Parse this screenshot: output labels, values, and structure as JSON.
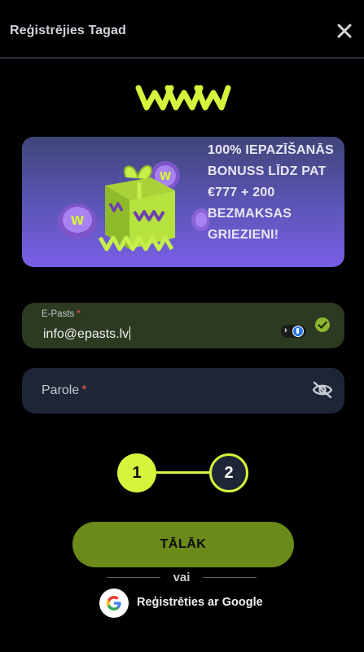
{
  "header": {
    "title": "Reģistrējies Tagad",
    "close_icon": "close-icon"
  },
  "logo": {
    "name": "www-logo",
    "color": "#d4f53c"
  },
  "banner": {
    "text": "100% IEPAZĪŠANĀS BONUSS LĪDZ PAT €777 + 200 BEZMAKSAS GRIEZIENI!"
  },
  "form": {
    "email": {
      "label": "E-Pasts",
      "required_mark": "*",
      "value": "info@epasts.lv"
    },
    "password": {
      "label": "Parole",
      "required_mark": "*"
    }
  },
  "stepper": {
    "step1": "1",
    "step2": "2",
    "active": 1
  },
  "actions": {
    "next_label": "TĀLĀK",
    "divider_text": "vai",
    "google_label": "Reģistrēties ar Google"
  },
  "colors": {
    "accent": "#d4f53c",
    "button": "#6a8a1a",
    "field_bg": "#1d2536",
    "error": "#ff5a4f"
  }
}
